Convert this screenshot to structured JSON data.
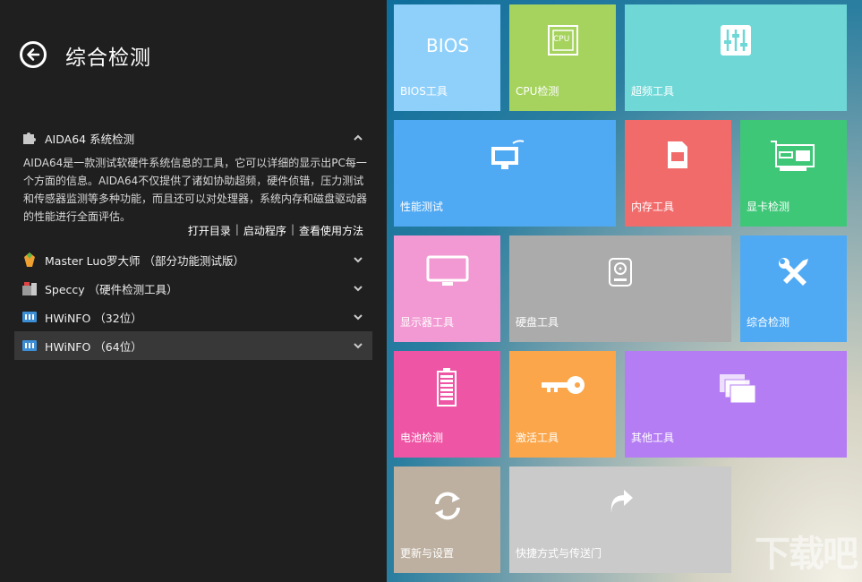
{
  "header": {
    "title": "综合检测"
  },
  "tools": [
    {
      "label": "AIDA64 系统检测",
      "icon": "puzzle-icon",
      "expanded": true
    },
    {
      "label": "Master Luo罗大师 （部分功能测试版）",
      "icon": "master-luo-icon"
    },
    {
      "label": "Speccy （硬件检测工具）",
      "icon": "speccy-icon"
    },
    {
      "label": "HWiNFO （32位）",
      "icon": "hwinfo-icon"
    },
    {
      "label": "HWiNFO （64位）",
      "icon": "hwinfo-icon",
      "selected": true
    }
  ],
  "aida_description": "AIDA64是一款测试软硬件系统信息的工具，它可以详细的显示出PC每一个方面的信息。AIDA64不仅提供了诸如协助超频，硬件侦错，压力测试和传感器监测等多种功能，而且还可以对处理器，系统内存和磁盘驱动器的性能进行全面评估。",
  "actions": {
    "open_dir": "打开目录",
    "launch": "启动程序",
    "howto": "查看使用方法",
    "sep": "|"
  },
  "tiles": [
    {
      "label": "BIOS工具",
      "icon_text": "BIOS",
      "color": "#8fd0fb"
    },
    {
      "label": "CPU检测",
      "icon_text": "CPU",
      "color": "#a6d35e"
    },
    {
      "label": "超频工具",
      "color": "#6fd8d7"
    },
    {
      "label": "性能测试",
      "color": "#4fa9f3"
    },
    {
      "label": "内存工具",
      "color": "#f26b6b"
    },
    {
      "label": "显卡检测",
      "color": "#3fc778"
    },
    {
      "label": "显示器工具",
      "color": "#f298d2"
    },
    {
      "label": "硬盘工具",
      "color": "#ababab"
    },
    {
      "label": "综合检测",
      "color": "#4fa9f3"
    },
    {
      "label": "电池检测",
      "color": "#ef55a5"
    },
    {
      "label": "激活工具",
      "color": "#fba64a"
    },
    {
      "label": "其他工具",
      "color": "#b57df4"
    },
    {
      "label": "更新与设置",
      "color": "#bdb0a0"
    },
    {
      "label": "快捷方式与传送门",
      "color": "#cacaca"
    }
  ],
  "watermark": "下载吧"
}
